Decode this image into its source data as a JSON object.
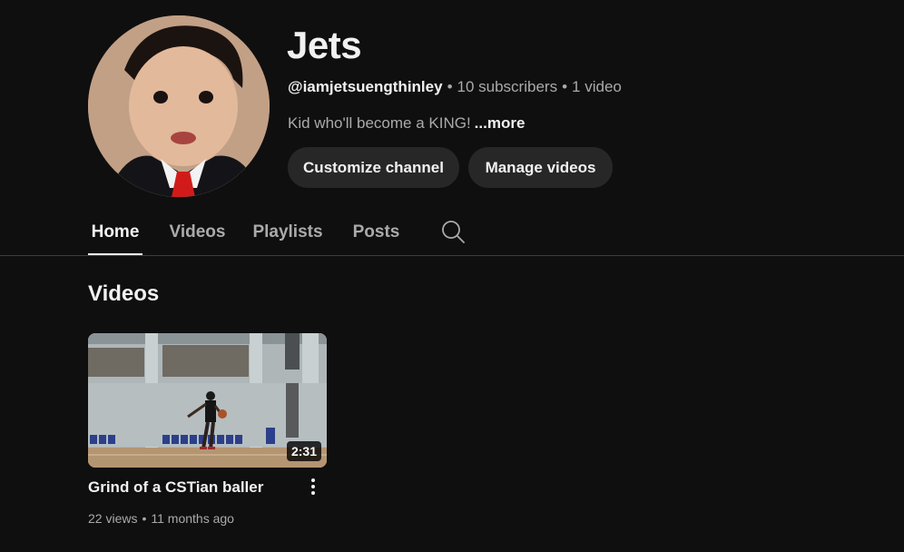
{
  "channel": {
    "name": "Jets",
    "handle": "@iamjetsuengthinley",
    "separator": "•",
    "subscribers": "10 subscribers",
    "video_count": "1 video",
    "description": "Kid who'll become a KING!",
    "more_label": "...more"
  },
  "actions": {
    "customize_label": "Customize channel",
    "manage_label": "Manage videos"
  },
  "tabs": [
    {
      "label": "Home",
      "active": true
    },
    {
      "label": "Videos",
      "active": false
    },
    {
      "label": "Playlists",
      "active": false
    },
    {
      "label": "Posts",
      "active": false
    }
  ],
  "section": {
    "title": "Videos"
  },
  "videos": [
    {
      "title": "Grind of a CSTian baller",
      "duration": "2:31",
      "views": "22 views",
      "age": "11 months ago"
    }
  ],
  "icons": {
    "search": "search-icon",
    "more": "more-vert-icon"
  },
  "colors": {
    "background": "#0f0f0f",
    "button_bg": "#272727",
    "secondary_text": "#aaaaaa",
    "primary_text": "#f1f1f1"
  }
}
